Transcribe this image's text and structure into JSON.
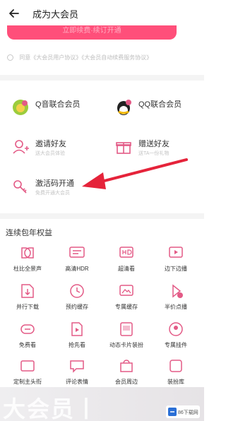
{
  "header": {
    "title": "成为大会员"
  },
  "pink_button": {
    "label": "立即续费·续订开通"
  },
  "agreement": {
    "text": "同意《大会员用户协议》《大会员自动续费服务协议》"
  },
  "partner_cards": [
    {
      "title": "Q音联合会员",
      "subtitle": ""
    },
    {
      "title": "QQ联合会员",
      "subtitle": ""
    },
    {
      "title": "邀请好友",
      "subtitle": "送大会员体验"
    },
    {
      "title": "赠送好友",
      "subtitle": "送TA一份礼物"
    },
    {
      "title": "激活码开通",
      "subtitle": "免费开通大会员"
    }
  ],
  "section": {
    "title": "连续包年权益"
  },
  "rights": [
    {
      "label": "杜比全景声"
    },
    {
      "label": "高清HDR"
    },
    {
      "label": "超清看"
    },
    {
      "label": "边下边播"
    },
    {
      "label": "并行下载"
    },
    {
      "label": "预约缓存"
    },
    {
      "label": "专属缓存"
    },
    {
      "label": "半价点播"
    },
    {
      "label": "免费看"
    },
    {
      "label": "抢先看"
    },
    {
      "label": "动态卡片装扮"
    },
    {
      "label": "专属挂件"
    },
    {
      "label": "定制主头衔"
    },
    {
      "label": "评论表情"
    },
    {
      "label": "会员周边"
    },
    {
      "label": "装扮库"
    }
  ],
  "bottom_banner": {
    "text": "大会员丨"
  },
  "logo": {
    "text": "86下载网"
  },
  "colors": {
    "accent": "#ff4f7a",
    "icon_pink": "#e35a86",
    "arrow_red": "#e5233a"
  }
}
